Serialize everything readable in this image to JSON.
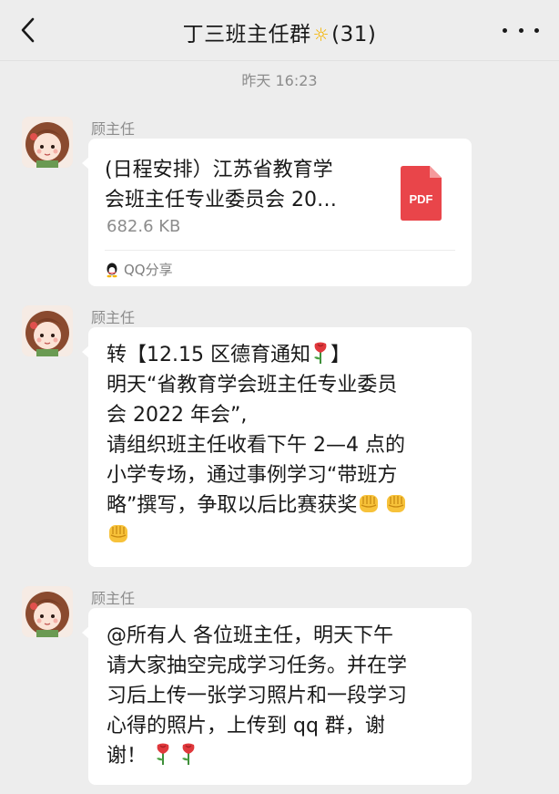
{
  "header": {
    "title": "丁三班主任群",
    "member_count": "(31)",
    "title_emoji": "sun-emoji"
  },
  "timestamp": "昨天 16:23",
  "messages": [
    {
      "sender": "顾主任",
      "file": {
        "name_lines": [
          "(日程安排）江苏省教育学",
          "会班主任专业委员会 20…"
        ],
        "size": "682.6 KB",
        "icon_label": "PDF",
        "source": "QQ分享"
      }
    },
    {
      "sender": "顾主任",
      "lines": [
        "转【12.15 区德育通知",
        "明天“省教育学会班主任专业委员",
        "会 2022 年会”,",
        "请组织班主任收看下午 2—4 点的",
        "小学专场，通过事例学习“带班方",
        "略”撰写，争取以后比赛获奖"
      ],
      "line1_suffix": "】"
    },
    {
      "sender": "顾主任",
      "lines": [
        "@所有人  各位班主任，明天下午",
        "请大家抽空完成学习任务。并在学",
        "习后上传一张学习照片和一段学习",
        "心得的照片，上传到 qq 群，谢",
        "谢！"
      ]
    }
  ],
  "icons": {
    "rose": "rose-emoji",
    "fist": "fist-emoji",
    "pdf": "pdf-file-icon",
    "qq": "qq-penguin-icon"
  },
  "colors": {
    "background": "#ededed",
    "bubble": "#ffffff",
    "pdf_red": "#e9454a",
    "muted_text": "#8c8c8c"
  }
}
